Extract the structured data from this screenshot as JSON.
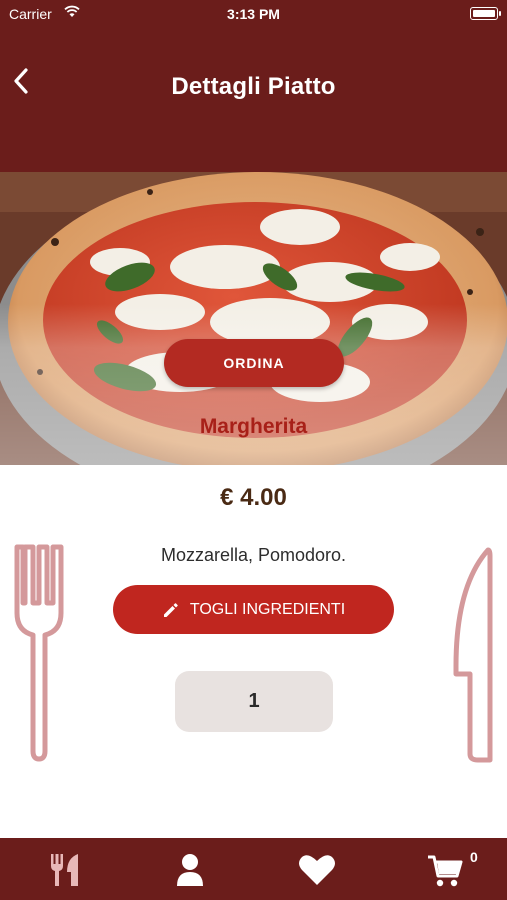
{
  "status_bar": {
    "carrier": "Carrier",
    "time": "3:13 PM"
  },
  "header": {
    "title": "Dettagli Piatto"
  },
  "dish": {
    "order_label": "ORDINA",
    "name": "Margherita",
    "price": "€ 4.00",
    "ingredients": "Mozzarella, Pomodoro.",
    "remove_ingredients_label": "TOGLI INGREDIENTI",
    "quantity": "1"
  },
  "tab_bar": {
    "items": [
      {
        "icon": "fork-knife-icon"
      },
      {
        "icon": "user-icon"
      },
      {
        "icon": "heart-icon"
      },
      {
        "icon": "cart-icon"
      }
    ],
    "cart_count": "0"
  },
  "colors": {
    "header": "#6b1d1b",
    "button": "#c0261f",
    "dish_name": "#a82018",
    "decor": "#d4999b"
  }
}
